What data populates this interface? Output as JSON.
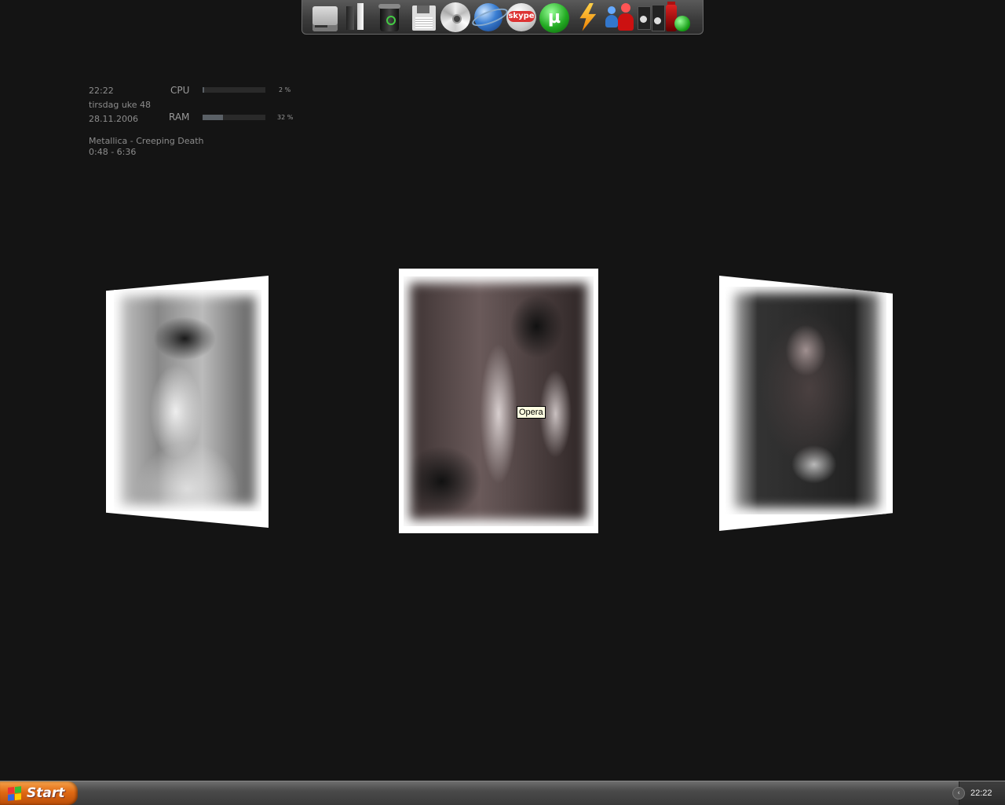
{
  "dock": {
    "icons": [
      "drive-icon",
      "bars-icon",
      "recycle-bin-icon",
      "floppy-icon",
      "cd-icon",
      "browser-globe-icon",
      "skype-icon",
      "utorrent-icon",
      "flash-icon",
      "messenger-users-icon",
      "speakers-icon",
      "gadget-icon"
    ],
    "skype_text": "skype",
    "utorrent_text": "µ"
  },
  "widget": {
    "time": "22:22",
    "day": "tirsdag uke 48",
    "date": "28.11.2006",
    "cpu_label": "CPU",
    "cpu_value": "2 %",
    "cpu_fraction": 0.02,
    "ram_label": "RAM",
    "ram_value": "32 %",
    "ram_fraction": 0.32,
    "track": "Metallica - Creeping Death",
    "track_time": "0:48 - 6:36"
  },
  "tooltip": "Opera",
  "taskbar": {
    "start_label": "Start",
    "clock": "22:22",
    "tray_arrow": "‹"
  }
}
